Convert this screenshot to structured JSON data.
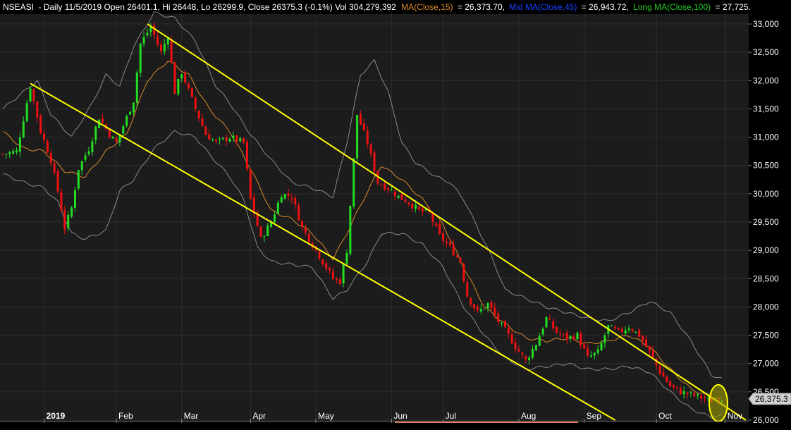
{
  "header": {
    "symbol": "NSEASI",
    "info": "- Daily 11/5/2019 Open 26401.1, Hi 26448, Lo 26299.9, Close 26375.3 (-0.1%) Vol 304,279,392",
    "ma_short_label": "MA(Close,15)",
    "ma_short_value": "= 26,373.70,",
    "ma_mid_label": "Mid MA(Close,45)",
    "ma_mid_value": "= 26,943.72,",
    "ma_long_label": "Long MA(Close,100)",
    "ma_long_value": "= 27,725."
  },
  "colors": {
    "background": "#000000",
    "plot_background": "#1c1c1c",
    "grid": "#2d2d2d",
    "up": "#22dd22",
    "down": "#ee1111",
    "ma_short": "#d98a2a",
    "bands": "#8a8a8a",
    "trendline": "#ffff00",
    "ma_mid_label": "#1a40ff",
    "ma_long_label": "#22cc22",
    "text": "#ffffff"
  },
  "chart_data": {
    "type": "candlestick",
    "title": "",
    "xlabel": "",
    "ylabel": "",
    "ylim": [
      26000,
      33150
    ],
    "y_ticks": [
      26000,
      26500,
      27000,
      27500,
      28000,
      28500,
      29000,
      29500,
      30000,
      30500,
      31000,
      31500,
      32000,
      32500,
      33000
    ],
    "y_tick_labels": [
      "26,000",
      "26,500",
      "27,000",
      "27,500",
      "28,000",
      "28,500",
      "29,000",
      "29,500",
      "30,000",
      "30,500",
      "31,000",
      "31,500",
      "32,000",
      "32,500",
      "33,000"
    ],
    "x_range": [
      0,
      216
    ],
    "x_ticks": [
      {
        "label": "2019",
        "x": 12
      },
      {
        "label": "Feb",
        "x": 33
      },
      {
        "label": "Mar",
        "x": 52
      },
      {
        "label": "Apr",
        "x": 72
      },
      {
        "label": "May",
        "x": 91
      },
      {
        "label": "Jun",
        "x": 113
      },
      {
        "label": "Jul",
        "x": 128
      },
      {
        "label": "Aug",
        "x": 150
      },
      {
        "label": "Sep",
        "x": 169
      },
      {
        "label": "Oct",
        "x": 190
      },
      {
        "label": "Nov",
        "x": 210
      }
    ],
    "close_marker": "26,375.3",
    "last_close": 26375.3,
    "close_anchors": [
      [
        0,
        30700
      ],
      [
        4,
        30750
      ],
      [
        8,
        31900
      ],
      [
        11,
        31100
      ],
      [
        14,
        30600
      ],
      [
        16,
        30050
      ],
      [
        18,
        29400
      ],
      [
        20,
        29750
      ],
      [
        22,
        30450
      ],
      [
        25,
        30800
      ],
      [
        28,
        31350
      ],
      [
        31,
        31050
      ],
      [
        33,
        30900
      ],
      [
        35,
        31200
      ],
      [
        38,
        31650
      ],
      [
        40,
        32650
      ],
      [
        43,
        32950
      ],
      [
        46,
        32500
      ],
      [
        48,
        32800
      ],
      [
        50,
        31800
      ],
      [
        52,
        32150
      ],
      [
        56,
        31500
      ],
      [
        59,
        31050
      ],
      [
        62,
        30900
      ],
      [
        66,
        31000
      ],
      [
        70,
        30900
      ],
      [
        72,
        29900
      ],
      [
        75,
        29200
      ],
      [
        78,
        29500
      ],
      [
        81,
        30000
      ],
      [
        84,
        29950
      ],
      [
        87,
        29400
      ],
      [
        90,
        29100
      ],
      [
        93,
        28800
      ],
      [
        96,
        28500
      ],
      [
        98,
        28450
      ],
      [
        100,
        29000
      ],
      [
        103,
        31400
      ],
      [
        106,
        30900
      ],
      [
        109,
        30200
      ],
      [
        112,
        30100
      ],
      [
        115,
        29950
      ],
      [
        118,
        29850
      ],
      [
        121,
        29700
      ],
      [
        124,
        29650
      ],
      [
        127,
        29250
      ],
      [
        130,
        29050
      ],
      [
        133,
        28800
      ],
      [
        135,
        28200
      ],
      [
        138,
        27900
      ],
      [
        141,
        28050
      ],
      [
        144,
        27750
      ],
      [
        147,
        27500
      ],
      [
        149,
        27300
      ],
      [
        152,
        27050
      ],
      [
        155,
        27350
      ],
      [
        158,
        27800
      ],
      [
        161,
        27550
      ],
      [
        164,
        27450
      ],
      [
        167,
        27500
      ],
      [
        170,
        27100
      ],
      [
        173,
        27200
      ],
      [
        176,
        27650
      ],
      [
        179,
        27550
      ],
      [
        182,
        27650
      ],
      [
        185,
        27500
      ],
      [
        188,
        27200
      ],
      [
        191,
        26850
      ],
      [
        194,
        26600
      ],
      [
        197,
        26500
      ],
      [
        200,
        26450
      ],
      [
        203,
        26400
      ],
      [
        206,
        26350
      ],
      [
        209,
        26380
      ]
    ],
    "ma_short_anchors": [
      [
        0,
        31100
      ],
      [
        6,
        30800
      ],
      [
        12,
        30750
      ],
      [
        18,
        30400
      ],
      [
        24,
        30300
      ],
      [
        30,
        30750
      ],
      [
        36,
        31050
      ],
      [
        42,
        32000
      ],
      [
        48,
        32350
      ],
      [
        54,
        32100
      ],
      [
        60,
        31500
      ],
      [
        66,
        31100
      ],
      [
        72,
        30450
      ],
      [
        78,
        29700
      ],
      [
        84,
        29550
      ],
      [
        90,
        29300
      ],
      [
        96,
        28850
      ],
      [
        100,
        29300
      ],
      [
        104,
        29800
      ],
      [
        110,
        30500
      ],
      [
        116,
        30250
      ],
      [
        122,
        29900
      ],
      [
        128,
        29450
      ],
      [
        134,
        28700
      ],
      [
        140,
        28000
      ],
      [
        146,
        27700
      ],
      [
        152,
        27450
      ],
      [
        158,
        27400
      ],
      [
        164,
        27450
      ],
      [
        170,
        27350
      ],
      [
        176,
        27400
      ],
      [
        182,
        27500
      ],
      [
        188,
        27300
      ],
      [
        194,
        26900
      ],
      [
        200,
        26550
      ],
      [
        206,
        26400
      ],
      [
        210,
        26370
      ]
    ],
    "upper_band_anchors": [
      [
        0,
        31500
      ],
      [
        6,
        31800
      ],
      [
        10,
        32000
      ],
      [
        14,
        31400
      ],
      [
        20,
        31000
      ],
      [
        26,
        31600
      ],
      [
        30,
        32100
      ],
      [
        34,
        31900
      ],
      [
        38,
        32600
      ],
      [
        44,
        33200
      ],
      [
        50,
        33100
      ],
      [
        56,
        32700
      ],
      [
        62,
        31900
      ],
      [
        66,
        31600
      ],
      [
        72,
        31050
      ],
      [
        78,
        30600
      ],
      [
        84,
        30200
      ],
      [
        90,
        30100
      ],
      [
        96,
        29950
      ],
      [
        100,
        30900
      ],
      [
        104,
        32100
      ],
      [
        108,
        32350
      ],
      [
        112,
        31800
      ],
      [
        116,
        30900
      ],
      [
        120,
        30550
      ],
      [
        126,
        30300
      ],
      [
        130,
        30200
      ],
      [
        134,
        29900
      ],
      [
        138,
        29400
      ],
      [
        142,
        28900
      ],
      [
        146,
        28300
      ],
      [
        152,
        28150
      ],
      [
        158,
        28000
      ],
      [
        164,
        27900
      ],
      [
        170,
        27800
      ],
      [
        176,
        27750
      ],
      [
        182,
        27900
      ],
      [
        188,
        28100
      ],
      [
        194,
        27900
      ],
      [
        200,
        27400
      ],
      [
        206,
        26800
      ],
      [
        210,
        26700
      ]
    ],
    "lower_band_anchors": [
      [
        0,
        30350
      ],
      [
        6,
        30200
      ],
      [
        12,
        30100
      ],
      [
        16,
        29850
      ],
      [
        20,
        29300
      ],
      [
        24,
        29200
      ],
      [
        30,
        29350
      ],
      [
        34,
        30050
      ],
      [
        38,
        30250
      ],
      [
        44,
        30800
      ],
      [
        50,
        31100
      ],
      [
        56,
        31000
      ],
      [
        60,
        30700
      ],
      [
        66,
        30300
      ],
      [
        70,
        29900
      ],
      [
        74,
        29050
      ],
      [
        78,
        28800
      ],
      [
        84,
        28750
      ],
      [
        90,
        28700
      ],
      [
        96,
        28150
      ],
      [
        100,
        28300
      ],
      [
        106,
        28800
      ],
      [
        110,
        29300
      ],
      [
        116,
        29300
      ],
      [
        122,
        29100
      ],
      [
        128,
        28700
      ],
      [
        134,
        28000
      ],
      [
        140,
        27500
      ],
      [
        146,
        27100
      ],
      [
        152,
        26900
      ],
      [
        158,
        26950
      ],
      [
        164,
        27000
      ],
      [
        170,
        26900
      ],
      [
        176,
        26900
      ],
      [
        182,
        26950
      ],
      [
        188,
        26850
      ],
      [
        194,
        26500
      ],
      [
        200,
        26200
      ],
      [
        206,
        26050
      ],
      [
        210,
        26100
      ]
    ],
    "trendlines": [
      {
        "from": [
          8,
          31950
        ],
        "to": [
          178,
          26000
        ]
      },
      {
        "from": [
          42,
          33000
        ],
        "to": [
          216,
          26000
        ]
      }
    ],
    "highlight": {
      "x": 208,
      "y": 26300
    }
  }
}
